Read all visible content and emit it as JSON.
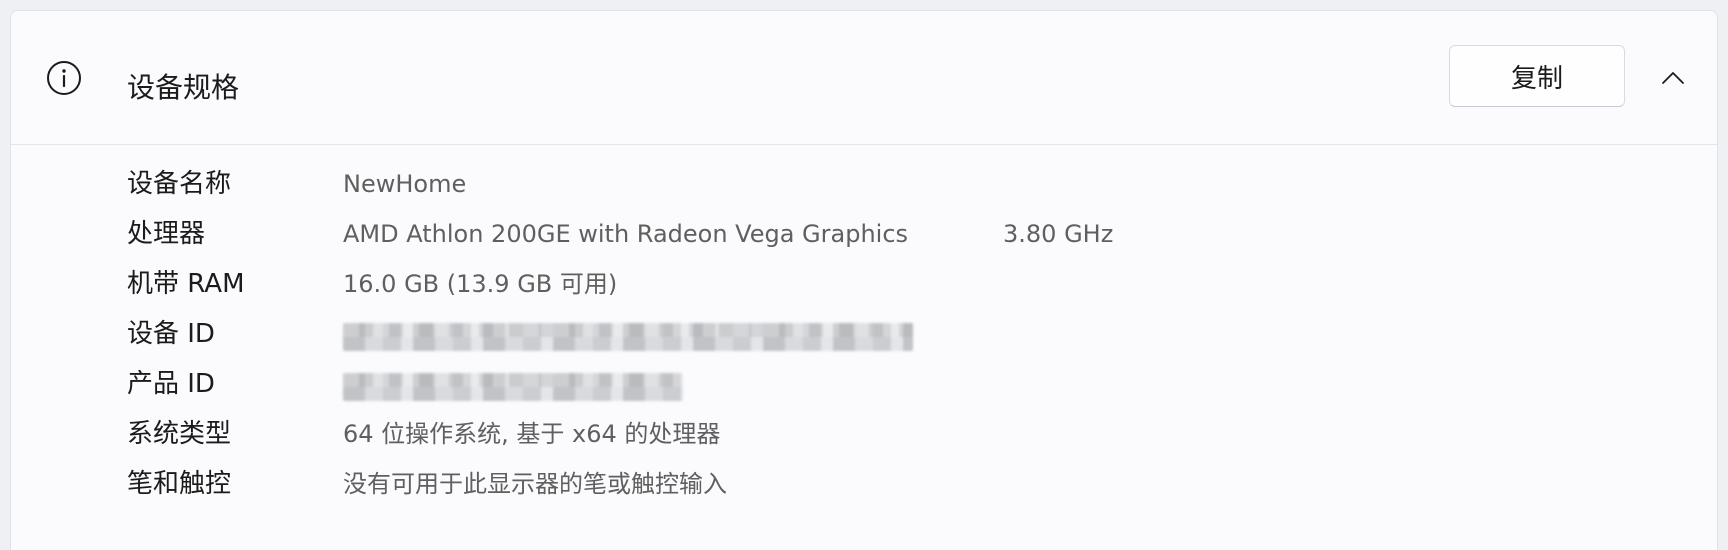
{
  "header": {
    "title": "设备规格",
    "icon": "info-icon",
    "copy_label": "复制",
    "collapse_icon": "chevron-up-icon"
  },
  "specs": {
    "device_name": {
      "label": "设备名称",
      "value": "NewHome"
    },
    "processor": {
      "label": "处理器",
      "value": "AMD Athlon 200GE with Radeon Vega Graphics",
      "speed": "3.80 GHz"
    },
    "ram": {
      "label": "机带 RAM",
      "value": "16.0 GB (13.9 GB 可用)"
    },
    "device_id": {
      "label": "设备 ID",
      "redacted": true
    },
    "product_id": {
      "label": "产品 ID",
      "redacted": true
    },
    "system_type": {
      "label": "系统类型",
      "value": "64 位操作系统, 基于 x64 的处理器"
    },
    "pen_touch": {
      "label": "笔和触控",
      "value": "没有可用于此显示器的笔或触控输入"
    }
  }
}
